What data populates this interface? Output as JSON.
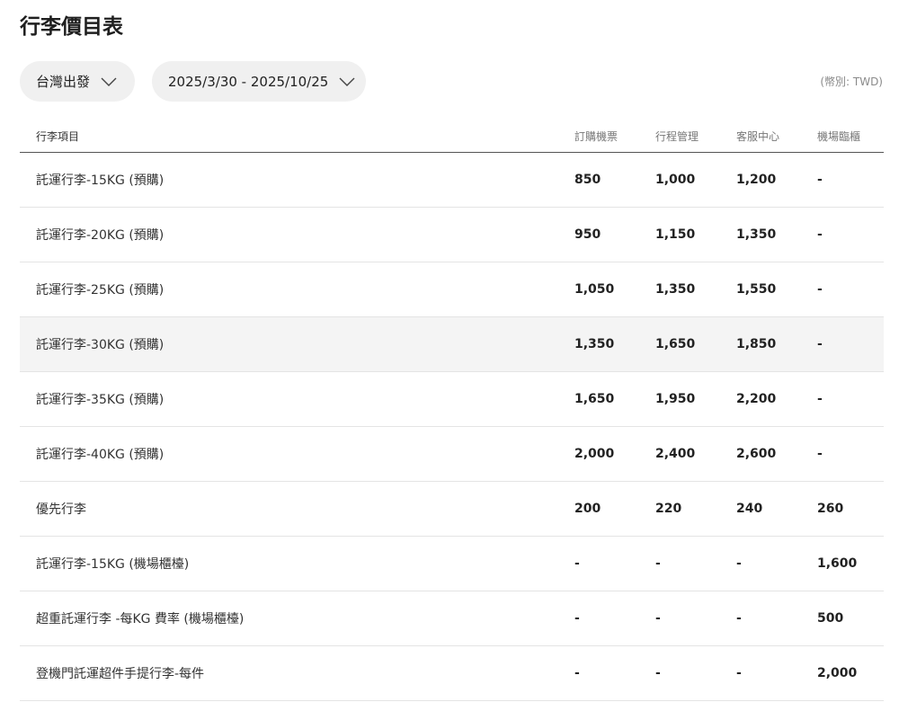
{
  "page": {
    "title": "行李價目表"
  },
  "filters": {
    "origin": "台灣出發",
    "date_range": "2025/3/30 - 2025/10/25",
    "currency": "(幣別: TWD)"
  },
  "table": {
    "headers": [
      "行李項目",
      "訂購機票",
      "行程管理",
      "客服中心",
      "機場臨櫃"
    ],
    "rows": [
      {
        "item": "託運行李-15KG (預購)",
        "booking": "850",
        "manage": "1,000",
        "service": "1,200",
        "airport": "-"
      },
      {
        "item": "託運行李-20KG (預購)",
        "booking": "950",
        "manage": "1,150",
        "service": "1,350",
        "airport": "-"
      },
      {
        "item": "託運行李-25KG (預購)",
        "booking": "1,050",
        "manage": "1,350",
        "service": "1,550",
        "airport": "-"
      },
      {
        "item": "託運行李-30KG (預購)",
        "booking": "1,350",
        "manage": "1,650",
        "service": "1,850",
        "airport": "-"
      },
      {
        "item": "託運行李-35KG (預購)",
        "booking": "1,650",
        "manage": "1,950",
        "service": "2,200",
        "airport": "-"
      },
      {
        "item": "託運行李-40KG (預購)",
        "booking": "2,000",
        "manage": "2,400",
        "service": "2,600",
        "airport": "-"
      },
      {
        "item": "優先行李",
        "booking": "200",
        "manage": "220",
        "service": "240",
        "airport": "260"
      },
      {
        "item": "託運行李-15KG (機場櫃檯)",
        "booking": "-",
        "manage": "-",
        "service": "-",
        "airport": "1,600"
      },
      {
        "item": "超重託運行李 -每KG 費率 (機場櫃檯)",
        "booking": "-",
        "manage": "-",
        "service": "-",
        "airport": "500"
      },
      {
        "item": "登機門託運超件手提行李-每件",
        "booking": "-",
        "manage": "-",
        "service": "-",
        "airport": "2,000"
      }
    ]
  },
  "colors": {
    "pill_bg": "#f0f0f0",
    "highlight_row": "#f4f4f4",
    "divider": "#e4e4e4"
  }
}
